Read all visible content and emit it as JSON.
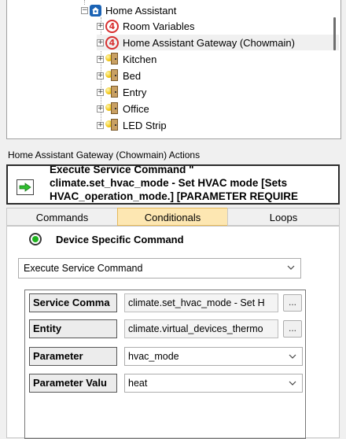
{
  "tree": {
    "root": {
      "label": "Home Assistant"
    },
    "items": [
      {
        "label": "Room Variables",
        "icon": "variables-icon"
      },
      {
        "label": "Home Assistant Gateway (Chowmain)",
        "icon": "driver-icon"
      },
      {
        "label": "Kitchen",
        "icon": "room-icon"
      },
      {
        "label": "Bed",
        "icon": "room-icon"
      },
      {
        "label": "Entry",
        "icon": "room-icon"
      },
      {
        "label": "Office",
        "icon": "room-icon"
      },
      {
        "label": "LED Strip",
        "icon": "room-icon"
      }
    ]
  },
  "actions": {
    "title": "Home Assistant Gateway (Chowmain) Actions",
    "item_text": "Execute Service Command \"\nclimate.set_hvac_mode - Set HVAC mode [Sets\nHVAC_operation_mode.] [PARAMETER REQUIRE"
  },
  "tabs": {
    "commands": "Commands",
    "conditionals": "Conditionals",
    "loops": "Loops",
    "active": "conditionals"
  },
  "command": {
    "device_specific_label": "Device Specific Command",
    "selected_command": "Execute Service Command"
  },
  "params": [
    {
      "label": "Service Comma",
      "value": "climate.set_hvac_mode - Set H",
      "button": "..."
    },
    {
      "label": "Entity",
      "value": "climate.virtual_devices_thermo",
      "button": "..."
    },
    {
      "label": "Parameter",
      "value": "hvac_mode"
    },
    {
      "label": "Parameter Valu",
      "value": "heat"
    }
  ],
  "colors": {
    "active_tab": "#fde7b2",
    "ha_blue": "#1b63b5",
    "driver_red": "#d83030",
    "go_green": "#1db31d"
  }
}
